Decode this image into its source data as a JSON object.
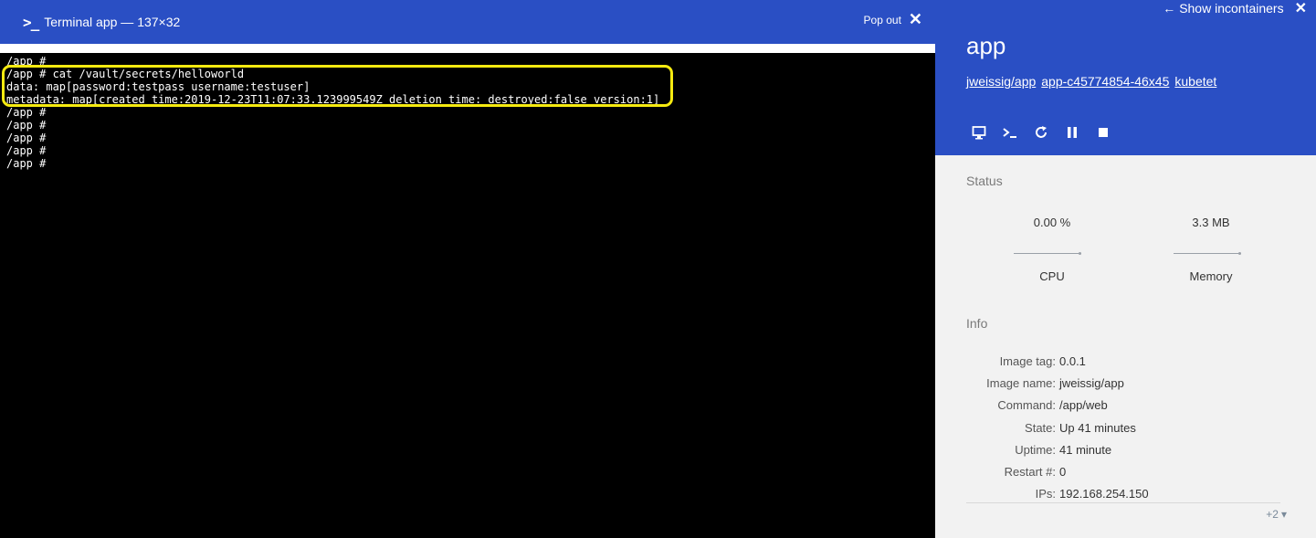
{
  "terminal": {
    "title": "Terminal app — 137×32",
    "popout_label": "Pop out",
    "lines": [
      "/app #",
      "/app # cat /vault/secrets/helloworld",
      "data: map[password:testpass username:testuser]",
      "metadata: map[created_time:2019-12-23T11:07:33.123999549Z deletion_time: destroyed:false version:1]",
      "/app #",
      "/app #",
      "/app #",
      "/app #",
      "/app #"
    ],
    "highlight_color": "#f5ea10"
  },
  "panel": {
    "show_containers_label": "Show incontainers",
    "container_name": "app",
    "links": [
      "jweissig/app",
      "app-c45774854-46x45",
      "kubetet"
    ],
    "toolbar_icons": [
      "monitor-icon",
      "terminal-icon",
      "restart-icon",
      "pause-icon",
      "stop-icon"
    ],
    "status": {
      "title": "Status",
      "cpu_value": "0.00 %",
      "cpu_label": "CPU",
      "memory_value": "3.3 MB",
      "memory_label": "Memory"
    },
    "info": {
      "title": "Info",
      "rows": [
        {
          "label": "Image tag:",
          "value": "0.0.1"
        },
        {
          "label": "Image name:",
          "value": "jweissig/app"
        },
        {
          "label": "Command:",
          "value": "/app/web"
        },
        {
          "label": "State:",
          "value": "Up 41 minutes"
        },
        {
          "label": "Uptime:",
          "value": "41 minute"
        },
        {
          "label": "Restart #:",
          "value": "0"
        },
        {
          "label": "IPs:",
          "value": "192.168.254.150"
        }
      ],
      "more_label": "+2"
    }
  },
  "colors": {
    "accent": "#2a4fc4",
    "terminal_bg": "#000000",
    "panel_bg": "#f2f2f2"
  }
}
